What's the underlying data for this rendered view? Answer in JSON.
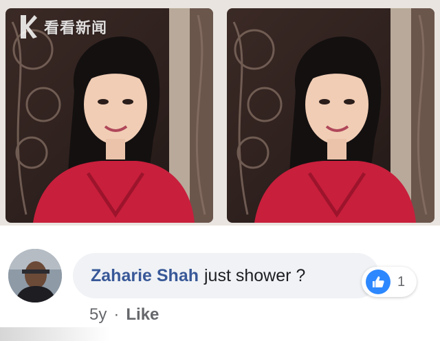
{
  "watermark": {
    "text": "看看新闻"
  },
  "photos": [
    {
      "name": "photo-left"
    },
    {
      "name": "photo-right"
    }
  ],
  "comment": {
    "author": "Zaharie Shah",
    "text": "just shower ?",
    "age": "5y",
    "separator": "·",
    "like_label": "Like",
    "reactions": {
      "type": "like",
      "count": "1"
    }
  },
  "colors": {
    "author": "#385898",
    "bubble": "#f0f2f5",
    "like_blue": "#2d88ff",
    "meta_gray": "#65676b"
  }
}
